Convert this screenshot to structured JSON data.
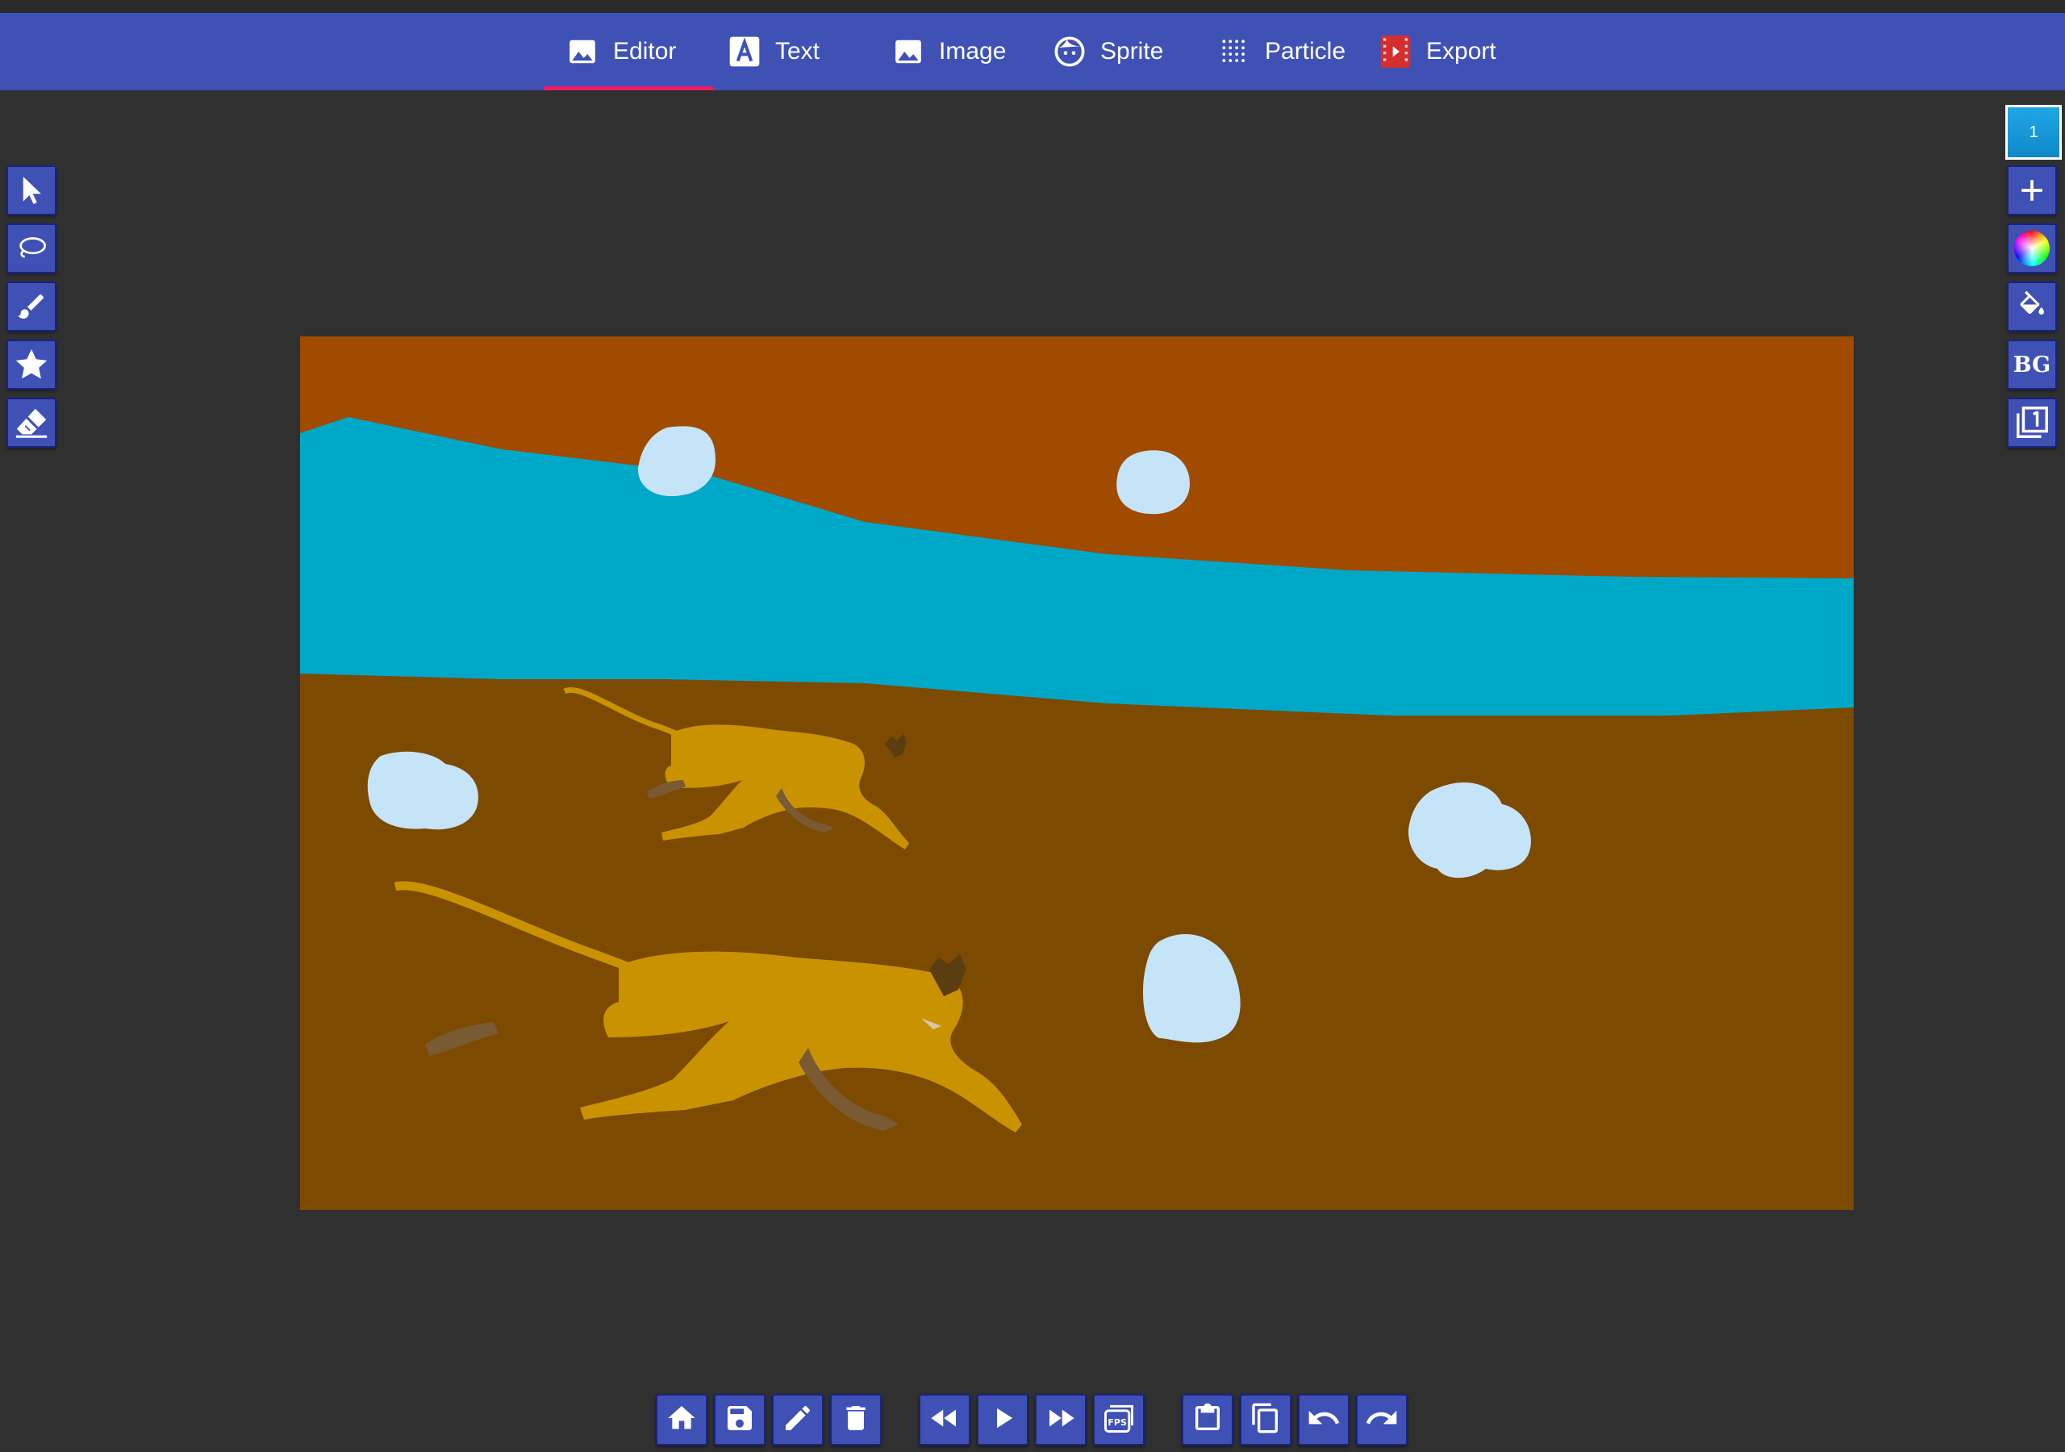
{
  "app": {
    "tabs": [
      {
        "label": "Editor",
        "icon": "image-icon",
        "active": true
      },
      {
        "label": "Text",
        "icon": "text-a-icon"
      },
      {
        "label": "Image",
        "icon": "image-icon"
      },
      {
        "label": "Sprite",
        "icon": "face-icon"
      },
      {
        "label": "Particle",
        "icon": "dots-grid-icon"
      },
      {
        "label": "Export",
        "icon": "film-icon"
      }
    ],
    "accent_color": "#3f51b5",
    "active_tab_indicator_color": "#e91e63"
  },
  "left_tools": [
    {
      "name": "select-tool",
      "icon": "arrow-pointer-icon"
    },
    {
      "name": "lasso-tool",
      "icon": "lasso-icon"
    },
    {
      "name": "brush-tool",
      "icon": "brush-icon"
    },
    {
      "name": "shape-tool",
      "icon": "star-icon"
    },
    {
      "name": "eraser-tool",
      "icon": "eraser-icon"
    }
  ],
  "right_panel": {
    "frame_number": "1",
    "bg_label": "BG",
    "tools": [
      {
        "name": "add-frame",
        "icon": "plus-icon"
      },
      {
        "name": "color-picker",
        "icon": "color-wheel-icon"
      },
      {
        "name": "fill",
        "icon": "paint-bucket-icon"
      },
      {
        "name": "background",
        "icon": "bg-icon"
      },
      {
        "name": "layers",
        "icon": "layers-icon"
      }
    ]
  },
  "canvas": {
    "colors": {
      "sky": "#a04b00",
      "river": "#00a8c8",
      "ground": "#7c4a00",
      "cloud": "#c6e4f7",
      "cat": "#c99200"
    }
  },
  "bottom_toolbar": [
    {
      "name": "home-button",
      "icon": "home-icon"
    },
    {
      "name": "save-button",
      "icon": "save-icon"
    },
    {
      "name": "edit-button",
      "icon": "pencil-icon"
    },
    {
      "name": "delete-button",
      "icon": "trash-icon"
    },
    {
      "name": "rewind-button",
      "icon": "rewind-icon"
    },
    {
      "name": "play-button",
      "icon": "play-icon"
    },
    {
      "name": "fast-forward-button",
      "icon": "fast-forward-icon"
    },
    {
      "name": "fps-button",
      "icon": "fps-icon"
    },
    {
      "name": "paste-button",
      "icon": "clipboard-icon"
    },
    {
      "name": "copy-button",
      "icon": "copy-icon"
    },
    {
      "name": "undo-button",
      "icon": "undo-icon"
    },
    {
      "name": "redo-button",
      "icon": "redo-icon"
    }
  ]
}
